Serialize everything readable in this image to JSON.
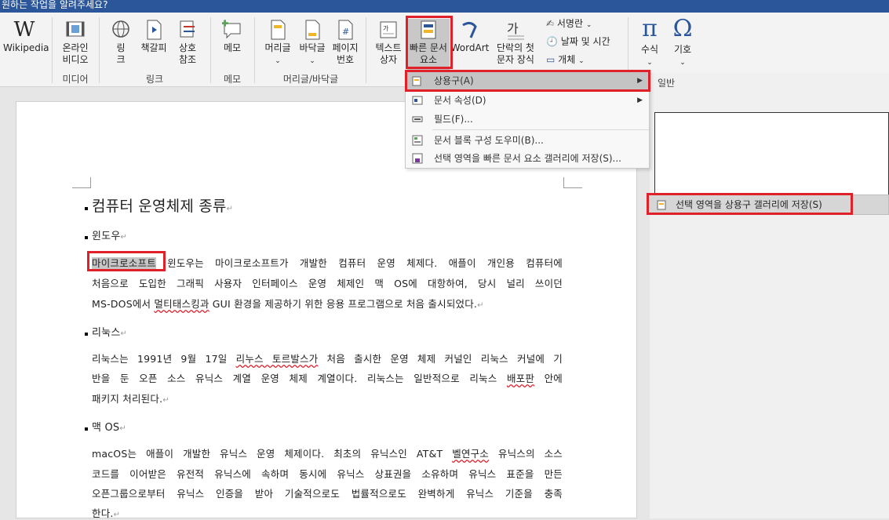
{
  "window": {
    "title": "원하는 작업을 알려주세요?"
  },
  "ribbon": {
    "wikipedia": "Wikipedia",
    "online_video": [
      "온라인",
      "비디오"
    ],
    "link": [
      "링",
      "크"
    ],
    "bookmark": "책갈피",
    "crossref": [
      "상호",
      "참조"
    ],
    "memo": "메모",
    "header": "머리글",
    "footer": "바닥글",
    "pagenum": [
      "페이지",
      "번호"
    ],
    "textbox": [
      "텍스트",
      "상자"
    ],
    "quickparts": [
      "빠른 문서",
      "요소"
    ],
    "wordart": "WordArt",
    "dropcap": [
      "단락의 첫",
      "문자 장식"
    ],
    "signature": "서명란",
    "datetime": "날짜 및 시간",
    "object": "개체",
    "equation": "수식",
    "symbol": "기호",
    "groups": {
      "media": "미디어",
      "links": "링크",
      "comments": "메모",
      "headerfooter": "머리글/바닥글"
    }
  },
  "menu": {
    "items": [
      {
        "label": "상용구(A)"
      },
      {
        "label": "문서 속성(D)"
      },
      {
        "label": "필드(F)..."
      },
      {
        "label": "문서 블록 구성 도우미(B)..."
      },
      {
        "label": "선택 영역을 빠른 문서 요소 갤러리에 저장(S)..."
      }
    ]
  },
  "right_pane": {
    "header": "일반"
  },
  "submenu": {
    "label": "선택 영역을 상용구 갤러리에 저장(S)"
  },
  "document": {
    "title": "컴퓨터 운영체제 종류",
    "sections": [
      {
        "heading": "윈도우",
        "lines": [
          {
            "sel": "마이크로소프트",
            "rest": " 윈도우는 마이크로소프트가 개발한 컴퓨터 운영 체제다. 애플이 개인용 컴퓨터에"
          },
          {
            "text": "처음으로 도입한 그래픽 사용자 인터페이스 운영 체제인 맥 OS에 대항하여, 당시 널리 쓰이던"
          },
          {
            "pre": "MS-DOS에서 ",
            "wavy": "멀티태스킹과",
            "post": " GUI 환경을 제공하기 위한 응용 프로그램으로 처음 출시되었다."
          }
        ]
      },
      {
        "heading": "리눅스",
        "lines": [
          {
            "pre": "리눅스는 1991년 9월 17일 ",
            "wavy": "리누스 토르발스가",
            "post": " 처음 출시한 운영 체제 커널인 리눅스 커널에 기"
          },
          {
            "pre": "반을 둔 오픈 소스 유닉스 계열 운영 체제 계열이다. 리눅스는 일반적으로 리눅스 ",
            "wavy": "배포판",
            "post": " 안에"
          },
          {
            "text": "패키지 처리된다."
          }
        ]
      },
      {
        "heading": "맥 OS",
        "lines": [
          {
            "pre": "macOS는 애플이 개발한 유닉스 운영 체제이다. 최초의 유닉스인 AT&T ",
            "wavy": "벨연구소",
            "post": " 유닉스의 소스"
          },
          {
            "text": "코드를 이어받은 유전적 유닉스에 속하며 동시에 유닉스 상표권을 소유하며 유닉스 표준을 만든"
          },
          {
            "text": "오픈그룹으로부터 유닉스 인증을 받아 기술적으로도 법률적으로도 완벽하게 유닉스 기준을 충족"
          },
          {
            "text": "한다."
          }
        ]
      }
    ]
  }
}
